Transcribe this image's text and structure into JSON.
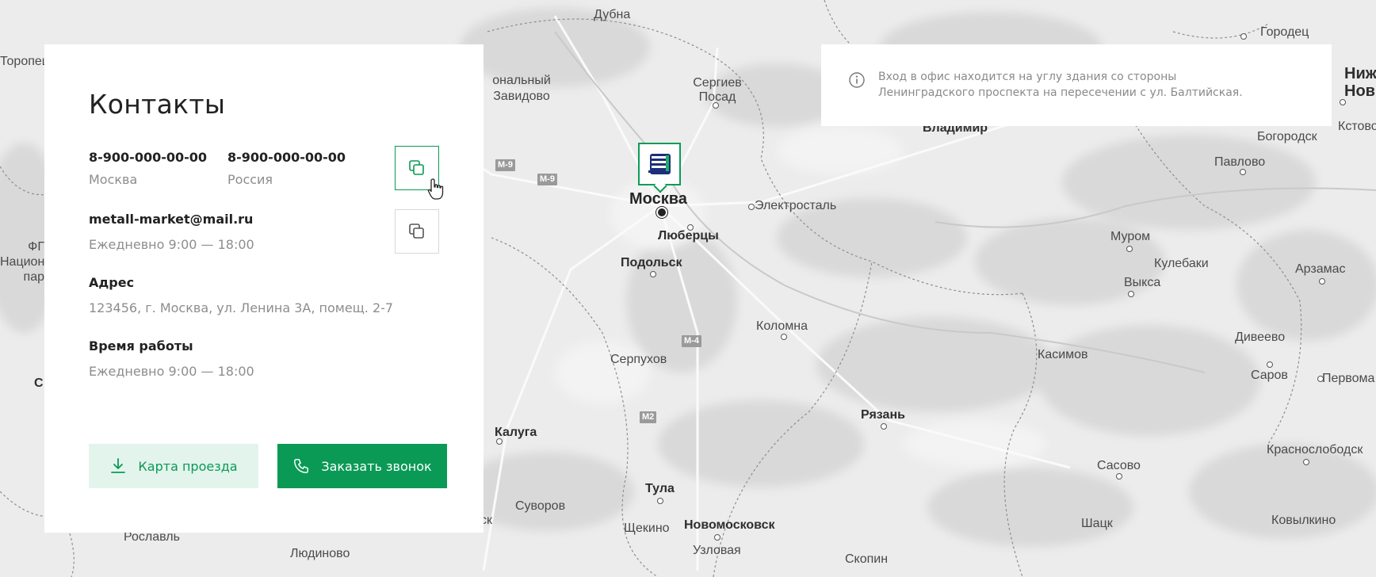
{
  "card": {
    "title": "Контакты",
    "phones": [
      {
        "number": "8-900-000-00-00",
        "region": "Москва"
      },
      {
        "number": "8-900-000-00-00",
        "region": "Россия"
      }
    ],
    "email": "metall-market@mail.ru",
    "email_hours": "Ежедневно 9:00 — 18:00",
    "address_label": "Адрес",
    "address": "123456, г. Москва, ул. Ленина 3А, помещ. 2-7",
    "hours_label": "Время работы",
    "hours": "Ежедневно 9:00 — 18:00",
    "map_button": "Карта проезда",
    "call_button": "Заказать звонок",
    "icons": [
      "copy-icon",
      "copy-icon",
      "download-icon",
      "phone-icon"
    ]
  },
  "notice": {
    "icon": "info-icon",
    "text": "Вход в офис находится на углу здания со стороны Ленинградского проспекта на пересечении с ул. Балтийская."
  },
  "map": {
    "cities": [
      {
        "name": "Дубна"
      },
      {
        "name": "Городец"
      },
      {
        "name": "Торопец"
      },
      {
        "name": "ональный Завидово"
      },
      {
        "name": "Сергиев Посад"
      },
      {
        "name": "Нижний Новгород"
      },
      {
        "name": "Владимир"
      },
      {
        "name": "Богородск"
      },
      {
        "name": "Кстово"
      },
      {
        "name": "Павлово"
      },
      {
        "name": "Москва"
      },
      {
        "name": "Электросталь"
      },
      {
        "name": "Люберцы"
      },
      {
        "name": "Подольск"
      },
      {
        "name": "Муром"
      },
      {
        "name": "Кулебаки"
      },
      {
        "name": "Арзамас"
      },
      {
        "name": "Выкса"
      },
      {
        "name": "ФГ Национ пар"
      },
      {
        "name": "Коломна"
      },
      {
        "name": "Дивеево"
      },
      {
        "name": "Серпухов"
      },
      {
        "name": "Касимов"
      },
      {
        "name": "Саров"
      },
      {
        "name": "Первома"
      },
      {
        "name": "С"
      },
      {
        "name": "Рязань"
      },
      {
        "name": "Калуга"
      },
      {
        "name": "Сасово"
      },
      {
        "name": "Краснослободск"
      },
      {
        "name": "Тула"
      },
      {
        "name": "Суворов"
      },
      {
        "name": "ск"
      },
      {
        "name": "Щекино"
      },
      {
        "name": "Новомосковск"
      },
      {
        "name": "Шацк"
      },
      {
        "name": "Ковылкино"
      },
      {
        "name": "Рославль"
      },
      {
        "name": "Людиново"
      },
      {
        "name": "Узловая"
      },
      {
        "name": "Скопин"
      }
    ],
    "roads": [
      "M-9",
      "M-9",
      "M-4",
      "M2"
    ],
    "marker_icon": "company-logo-icon"
  }
}
